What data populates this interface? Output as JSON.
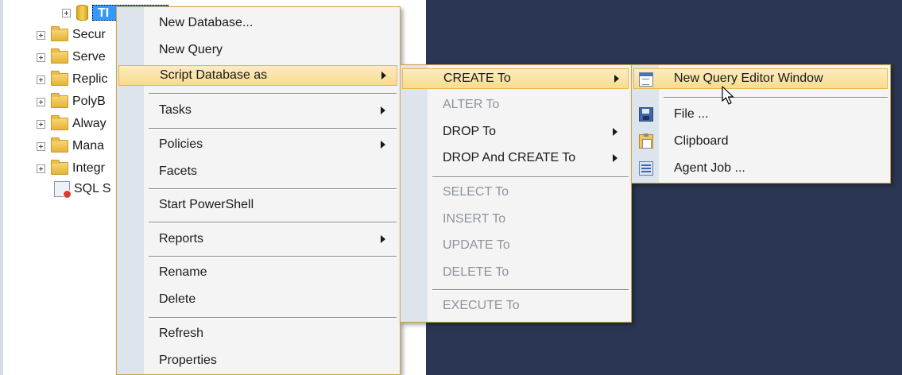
{
  "explorer": {
    "db_label": "TI",
    "nodes": [
      "Secur",
      "Serve",
      "Replic",
      "PolyB",
      "Alway",
      "Mana",
      "Integr"
    ],
    "agent_label": "SQL S"
  },
  "context_menu": {
    "new_database": "New Database...",
    "new_query": "New Query",
    "script_database_as": "Script Database as",
    "tasks": "Tasks",
    "policies": "Policies",
    "facets": "Facets",
    "start_powershell": "Start PowerShell",
    "reports": "Reports",
    "rename": "Rename",
    "delete": "Delete",
    "refresh": "Refresh",
    "properties": "Properties"
  },
  "script_submenu": {
    "create_to": "CREATE To",
    "alter_to": "ALTER To",
    "drop_to": "DROP To",
    "drop_and_create_to": "DROP And CREATE To",
    "select_to": "SELECT To",
    "insert_to": "INSERT To",
    "update_to": "UPDATE To",
    "delete_to": "DELETE To",
    "execute_to": "EXECUTE To"
  },
  "create_submenu": {
    "new_query_editor_window": "New Query Editor Window",
    "file": "File ...",
    "clipboard": "Clipboard",
    "agent_job": "Agent Job ..."
  },
  "icons": {
    "new_query_editor_window": "query-window-icon",
    "file": "save-file-icon",
    "clipboard": "clipboard-icon",
    "agent_job": "agent-job-icon"
  },
  "colors": {
    "menu_background": "#f4f4f4",
    "menu_gutter": "#dde4ec",
    "menu_highlight": "#f8dc8c",
    "menu_border": "#c9a54a",
    "document_area": "#2b3752",
    "tree_selection": "#3399ff",
    "disabled_text": "#8e949c"
  }
}
